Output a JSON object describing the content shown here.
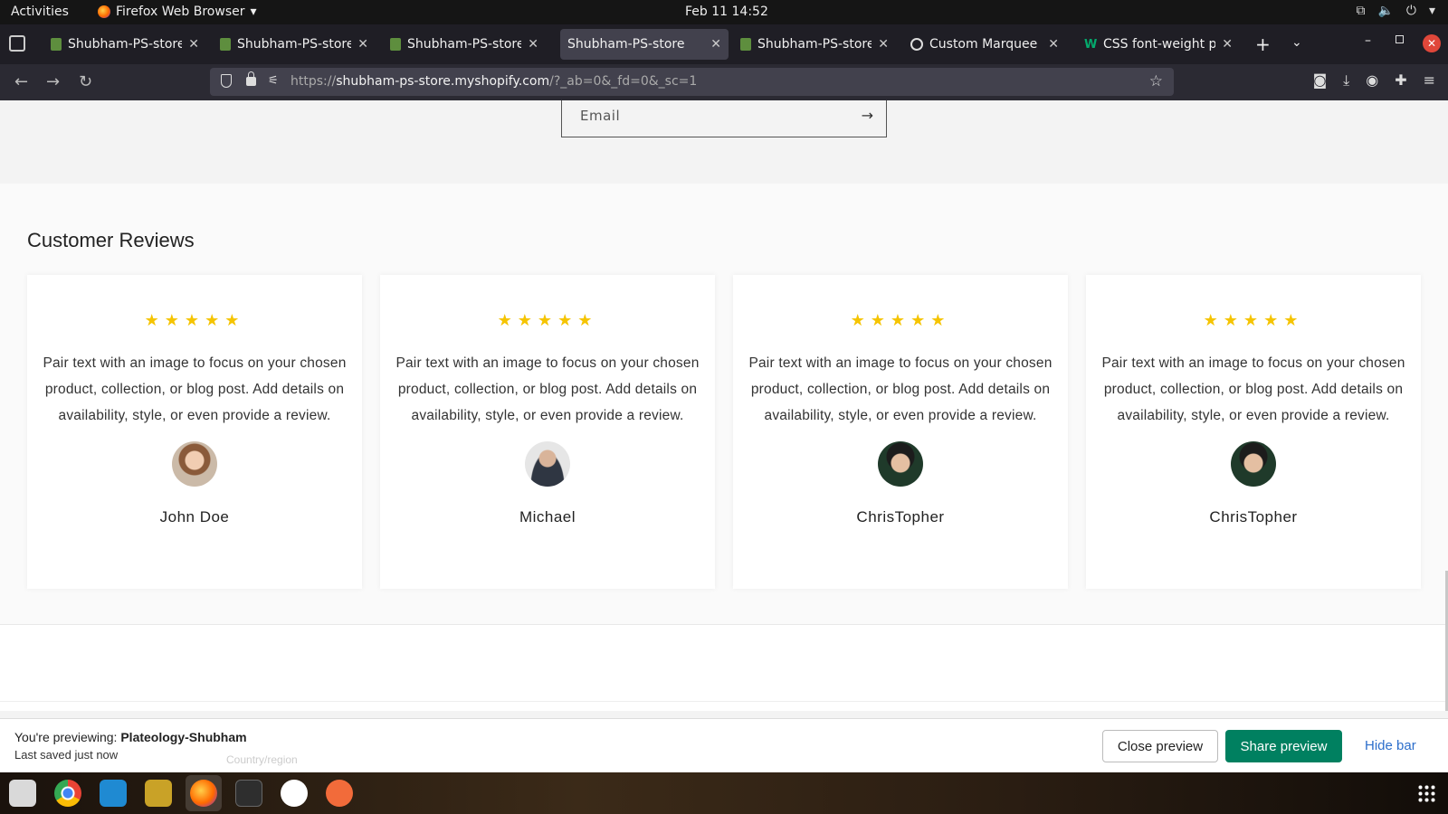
{
  "system_bar": {
    "activities": "Activities",
    "app_name": "Firefox Web Browser",
    "clock": "Feb 11  14:52"
  },
  "tabs": [
    {
      "title": "Shubham-PS-store ·",
      "active": false
    },
    {
      "title": "Shubham-PS-store ·",
      "active": false
    },
    {
      "title": "Shubham-PS-store ·",
      "active": false
    },
    {
      "title": "Shubham-PS-store",
      "active": true
    },
    {
      "title": "Shubham-PS-store ·",
      "active": false
    },
    {
      "title": "Custom Marquee Se",
      "active": false
    },
    {
      "title": "CSS font-weight pro",
      "active": false
    }
  ],
  "navbar": {
    "url_scheme": "https://",
    "url_host": "shubham-ps-store.myshopify.com",
    "url_rest": "/?_ab=0&_fd=0&_sc=1"
  },
  "newsletter": {
    "email_placeholder": "Email"
  },
  "reviews": {
    "heading": "Customer Reviews",
    "items": [
      {
        "stars": "★★★★★",
        "text": "Pair text with an image to focus on your chosen product, collection, or blog post. Add details on availability, style, or even provide a review.",
        "name": "John Doe"
      },
      {
        "stars": "★★★★★",
        "text": "Pair text with an image to focus on your chosen product, collection, or blog post. Add details on availability, style, or even provide a review.",
        "name": "Michael"
      },
      {
        "stars": "★★★★★",
        "text": "Pair text with an image to focus on your chosen product, collection, or blog post. Add details on availability, style, or even provide a review.",
        "name": "ChrisTopher"
      },
      {
        "stars": "★★★★★",
        "text": "Pair text with an image to focus on your chosen product, collection, or blog post. Add details on availability, style, or even provide a review.",
        "name": "ChrisTopher"
      }
    ]
  },
  "preview_bar": {
    "previewing_label": "You're previewing:",
    "theme_name": "Plateology-Shubham",
    "saved_status": "Last saved just now",
    "ghost_text": "Country/region",
    "close_label": "Close preview",
    "share_label": "Share preview",
    "hide_label": "Hide bar"
  },
  "colors": {
    "star": "#f5c400",
    "share_button": "#008060",
    "link": "#2c6ecb"
  }
}
